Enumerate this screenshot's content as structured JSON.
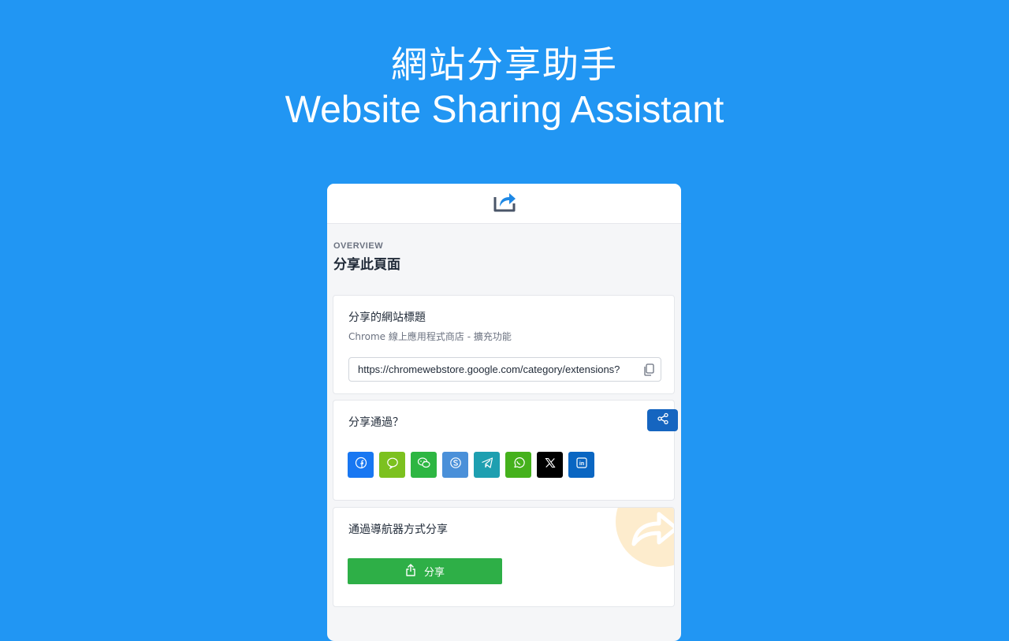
{
  "hero": {
    "title_zh": "網站分享助手",
    "title_en": "Website Sharing Assistant"
  },
  "colors": {
    "background": "#2196f3",
    "accent": "#1565c0",
    "share_button": "#2eaf47"
  },
  "panel": {
    "header_icon": "share-arrow-icon",
    "overview_label": "OVERVIEW",
    "heading": "分享此頁面",
    "site_card": {
      "title": "分享的網站標題",
      "site_title": "Chrome 線上應用程式商店 - 擴充功能",
      "url": "https://chromewebstore.google.com/category/extensions?",
      "copy_icon": "copy-icon"
    },
    "share_via": {
      "title": "分享通過？",
      "fab_icon": "share-nodes-icon",
      "networks": [
        {
          "name": "facebook",
          "icon": "facebook-icon",
          "color": "#1877f2"
        },
        {
          "name": "line",
          "icon": "line-icon",
          "color": "#7cc11f"
        },
        {
          "name": "wechat",
          "icon": "wechat-icon",
          "color": "#2db642"
        },
        {
          "name": "skype",
          "icon": "skype-icon",
          "color": "#4a90d9"
        },
        {
          "name": "telegram",
          "icon": "telegram-icon",
          "color": "#1e9fb0"
        },
        {
          "name": "whatsapp",
          "icon": "whatsapp-icon",
          "color": "#45b11c"
        },
        {
          "name": "x",
          "icon": "x-icon",
          "color": "#000000"
        },
        {
          "name": "linkedin",
          "icon": "linkedin-icon",
          "color": "#0a66c2"
        }
      ]
    },
    "browser_share": {
      "title": "通過導航器方式分享",
      "button_label": "分享",
      "button_icon": "upload-share-icon"
    }
  }
}
